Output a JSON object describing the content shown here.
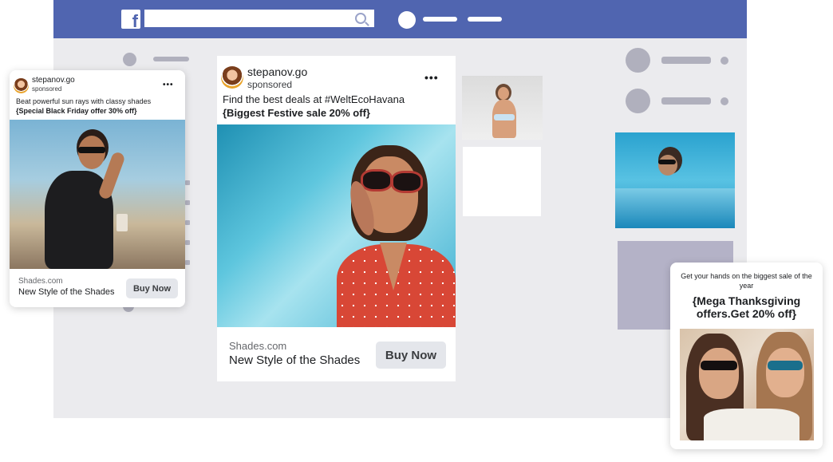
{
  "browser": {
    "logo_text": "f"
  },
  "main_ad": {
    "account": "stepanov.go",
    "sponsored": "sponsored",
    "more": "•••",
    "text_line1": "Find the best deals at #WeltEcoHavana",
    "text_line2": "{Biggest Festive sale 20% off}",
    "domain": "Shades.com",
    "headline": "New Style of the Shades",
    "cta": "Buy Now"
  },
  "left_ad": {
    "account": "stepanov.go",
    "sponsored": "sponsored",
    "more": "•••",
    "text_line1": "Beat powerful sun rays with classy shades",
    "text_line2": "{Special Black Friday offer 30% off}",
    "domain": "Shades.com",
    "headline": "New Style of the Shades",
    "cta": "Buy Now"
  },
  "right_ad": {
    "intro": "Get your hands on the biggest sale of the year",
    "headline": "{Mega Thanksgiving offers.Get 20% off}"
  },
  "colors": {
    "topbar": "#5065b0",
    "page_bg": "#ebebee",
    "placeholder": "#b0b0bd",
    "button_bg": "#e4e6eb"
  }
}
